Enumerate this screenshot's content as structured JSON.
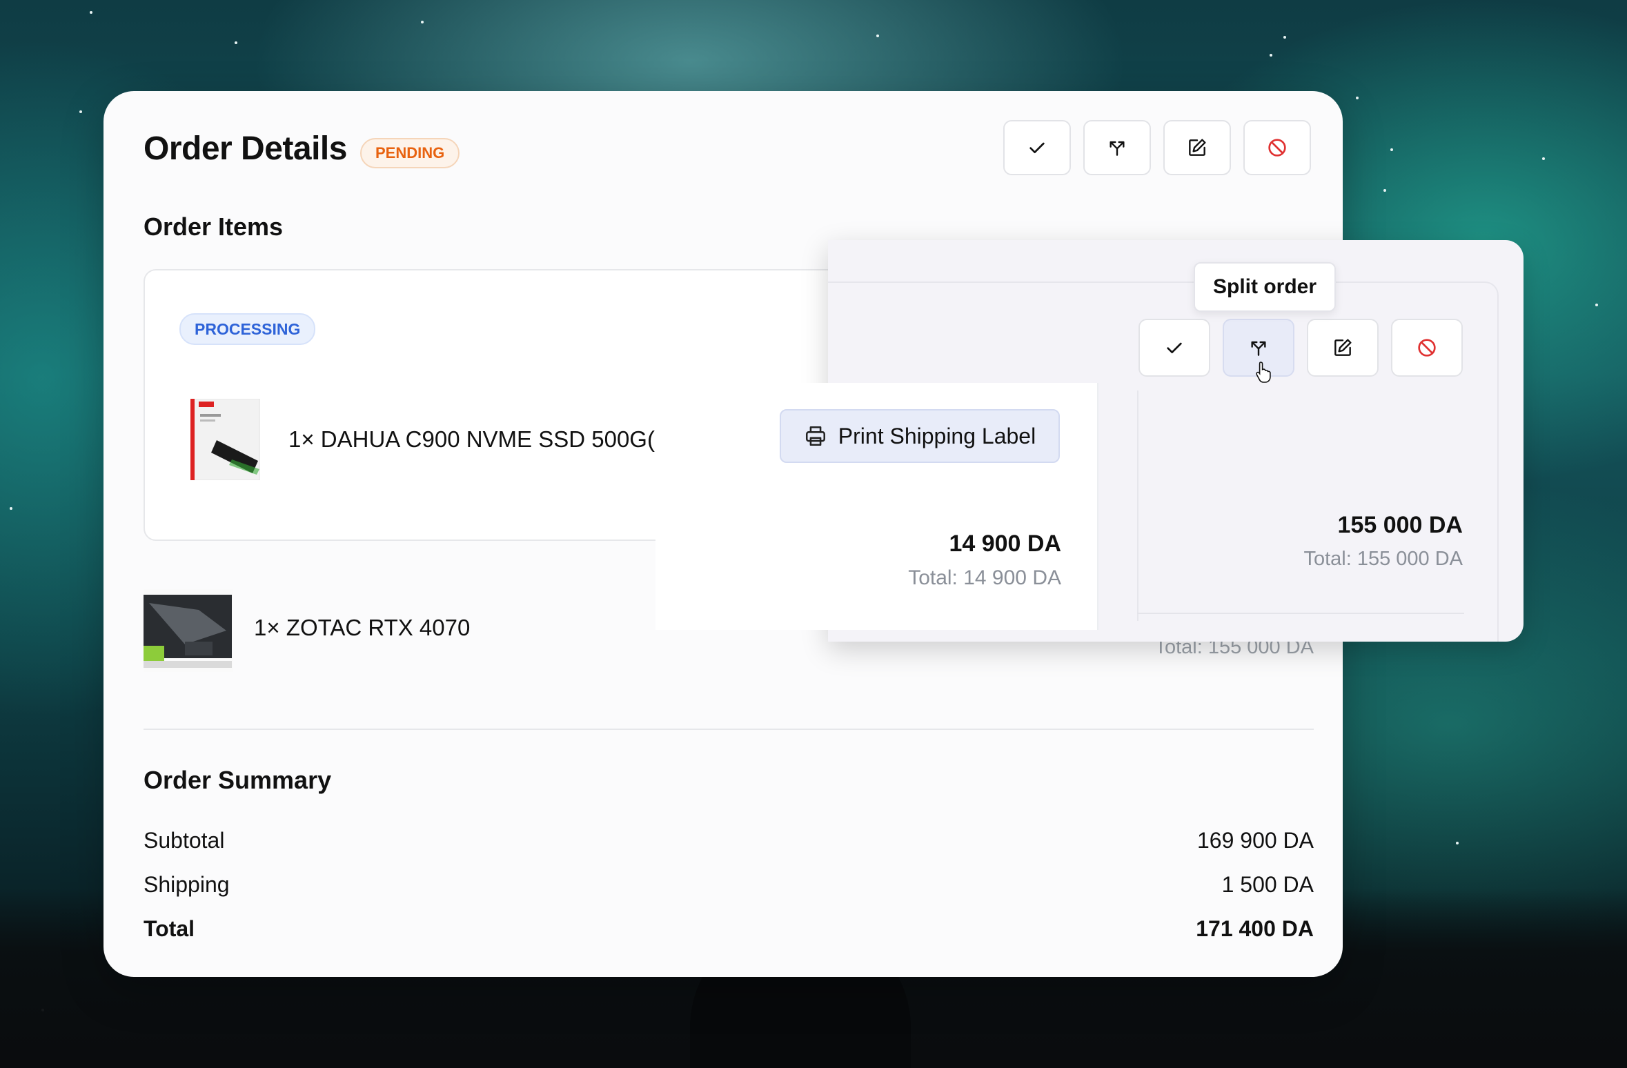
{
  "header": {
    "title": "Order Details",
    "status": "PENDING"
  },
  "toolbar": {
    "icons": [
      "check-icon",
      "split-icon",
      "edit-icon",
      "cancel-icon"
    ]
  },
  "items_section": {
    "title": "Order Items",
    "group_status": "PROCESSING",
    "items": [
      {
        "name": "1× DAHUA C900 NVME SSD 500G(",
        "price": "14 900 DA",
        "total": "Total: 14 900 DA"
      },
      {
        "name": "1× ZOTAC RTX 4070",
        "price": "155 000 DA",
        "total": "Total: 155 000 DA"
      }
    ]
  },
  "actions": {
    "print_label": "Print Shipping Label",
    "tooltip": "Split order"
  },
  "summary": {
    "title": "Order Summary",
    "rows": [
      {
        "label": "Subtotal",
        "value": "169 900 DA"
      },
      {
        "label": "Shipping",
        "value": "1 500 DA"
      },
      {
        "label": "Total",
        "value": "171 400 DA"
      }
    ]
  },
  "colors": {
    "pending": "#e8620f",
    "processing": "#2e63d8",
    "cancel": "#e03131"
  }
}
